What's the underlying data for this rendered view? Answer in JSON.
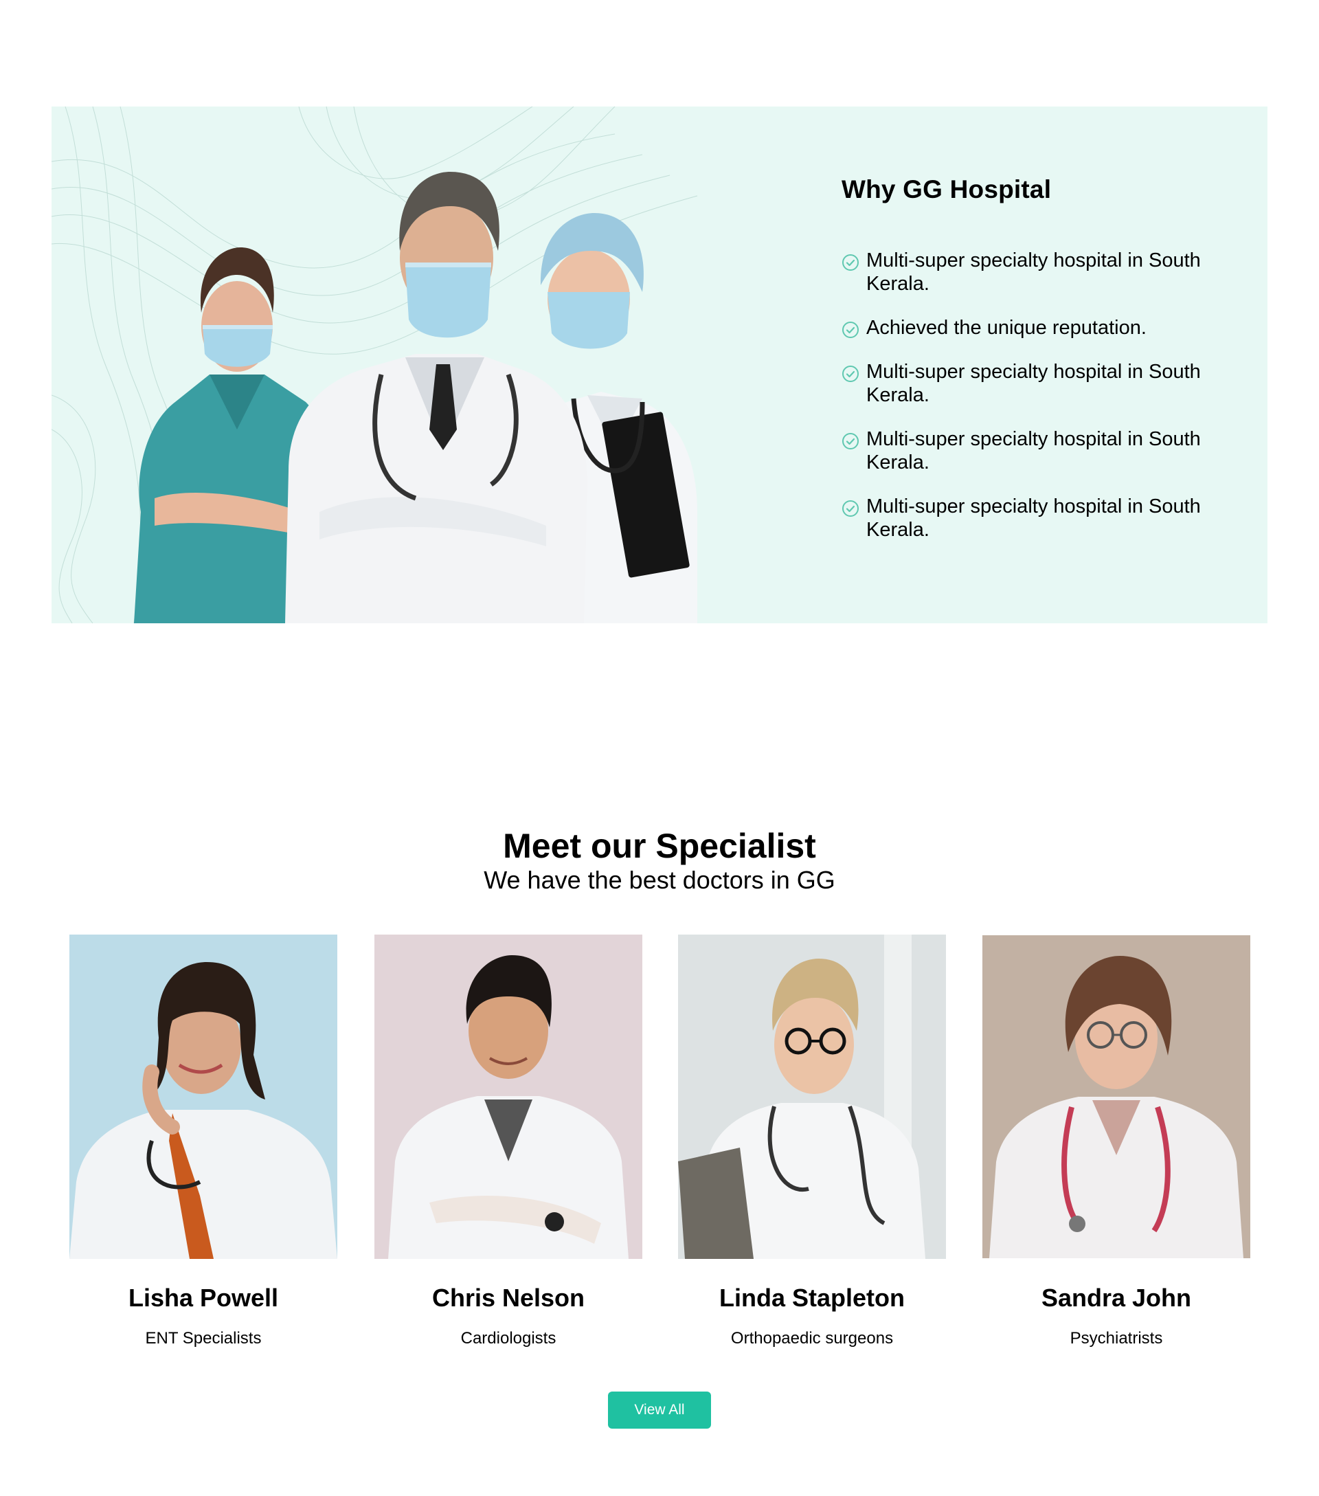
{
  "why_section": {
    "title": "Why GG Hospital",
    "items": [
      "Multi-super specialty hospital in South Kerala.",
      "Achieved the unique reputation.",
      "Multi-super specialty hospital in South Kerala.",
      "Multi-super specialty hospital in South Kerala.",
      "Multi-super specialty hospital in South Kerala."
    ],
    "icon": "check-circle-icon",
    "colors": {
      "background": "#e7f8f4",
      "check": "#5fc8b0"
    }
  },
  "specialists": {
    "title": "Meet our Specialist",
    "subtitle": "We have the best doctors in GG",
    "doctors": [
      {
        "name": "Lisha Powell",
        "role": "ENT Specialists"
      },
      {
        "name": "Chris Nelson",
        "role": "Cardiologists"
      },
      {
        "name": "Linda Stapleton",
        "role": "Orthopaedic surgeons"
      },
      {
        "name": "Sandra John",
        "role": "Psychiatrists"
      }
    ],
    "view_all_label": "View All",
    "colors": {
      "button": "#1fc1a1"
    }
  }
}
